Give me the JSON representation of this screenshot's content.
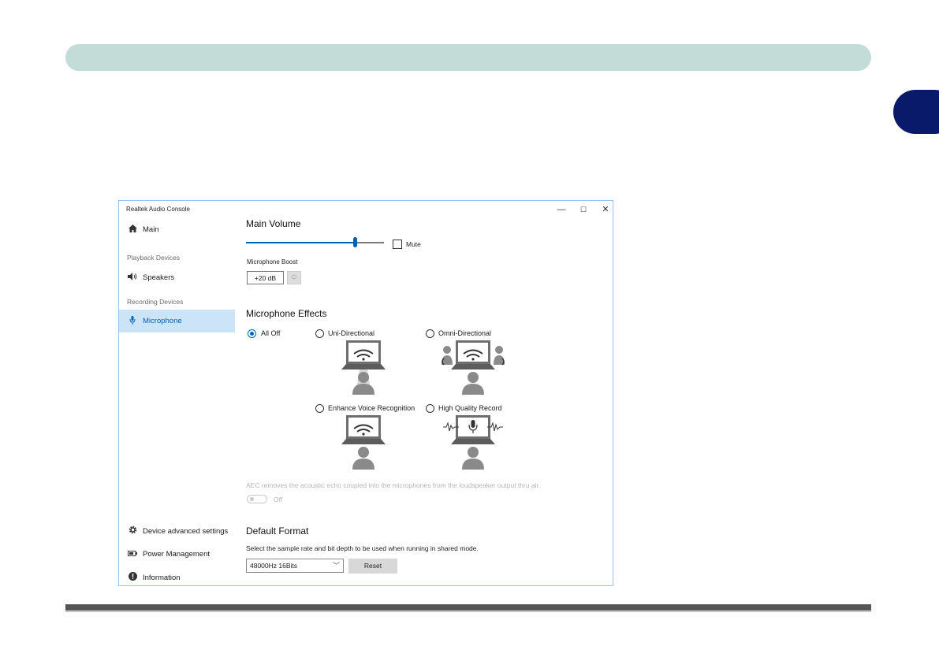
{
  "window": {
    "title": "Realtek Audio Console",
    "controls": {
      "minimize": "—",
      "maximize": "☐",
      "close": "✕"
    }
  },
  "sidebar": {
    "main": {
      "label": "Main",
      "icon": "home-icon"
    },
    "playback_group": "Playback Devices",
    "speakers": {
      "label": "Speakers",
      "icon": "speaker-icon"
    },
    "recording_group": "Recording Devices",
    "microphone": {
      "label": "Microphone",
      "icon": "microphone-icon"
    },
    "device_advanced": {
      "label": "Device advanced settings",
      "icon": "gear-icon"
    },
    "power": {
      "label": "Power Management",
      "icon": "battery-icon"
    },
    "information": {
      "label": "Information",
      "icon": "info-icon"
    }
  },
  "main_volume": {
    "title": "Main Volume",
    "level_fraction": 0.79,
    "mute_label": "Mute",
    "mute_checked": false
  },
  "boost": {
    "label": "Microphone Boost",
    "value": "+20 dB"
  },
  "effects": {
    "title": "Microphone Effects",
    "options": {
      "all_off": "All Off",
      "uni": "Uni-Directional",
      "omni": "Omni-Directional",
      "enhance": "Enhance Voice Recognition",
      "hq": "High Quality Record"
    },
    "selected": "All Off"
  },
  "aec": {
    "description": "AEC removes the acoustic echo coupled into the microphones from the loudspeaker output thru air.",
    "state": "Off"
  },
  "default_format": {
    "title": "Default Format",
    "description": "Select the sample rate and bit depth to be used when running in shared mode.",
    "selected": "48000Hz 16Bits",
    "reset_label": "Reset"
  },
  "colors": {
    "accent": "#0063b1",
    "header_bar": "#c3dcd7",
    "chapter_tab": "#0a1a6b",
    "selected_nav": "#cce4f7"
  }
}
